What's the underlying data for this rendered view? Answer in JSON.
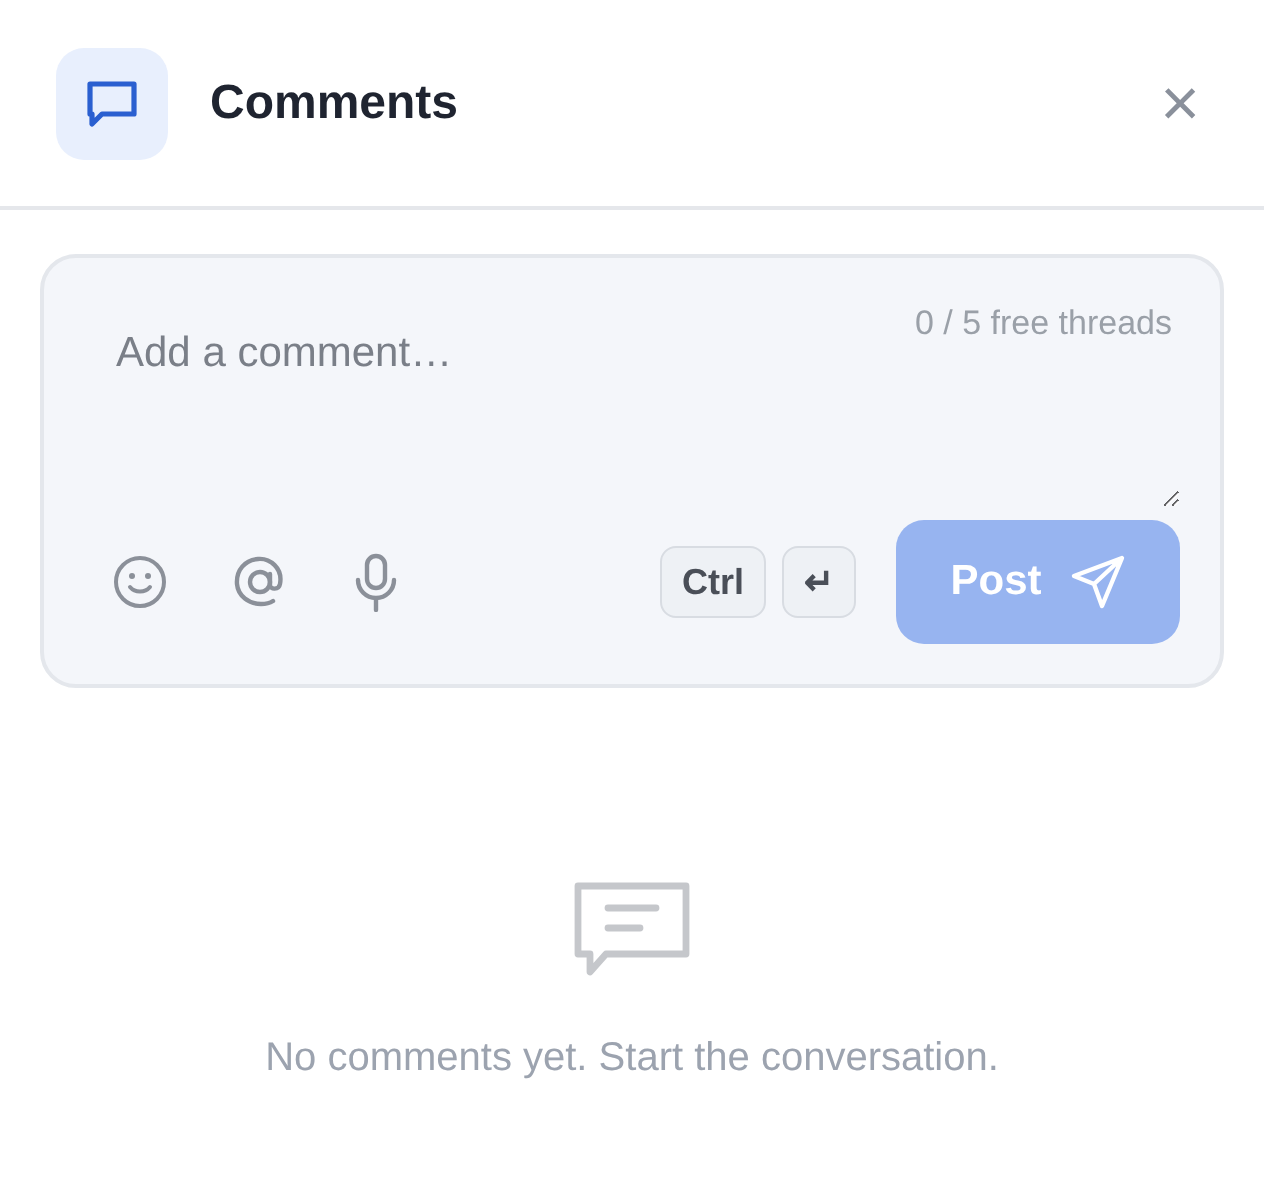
{
  "header": {
    "title": "Comments",
    "close": "×"
  },
  "composer": {
    "placeholder": "Add a comment…",
    "counter": "0 / 5 free threads",
    "keys": [
      "Ctrl",
      "↵"
    ],
    "post": {
      "label": "Post",
      "disabled": true
    }
  },
  "empty_state": {
    "message": "No comments yet. Start the conversation."
  }
}
